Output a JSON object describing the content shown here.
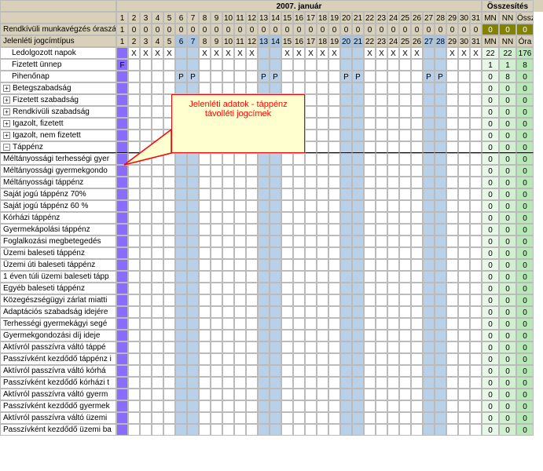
{
  "month_title": "2007. január",
  "summary_title": "Összesítés",
  "days": [
    1,
    2,
    3,
    4,
    5,
    6,
    7,
    8,
    9,
    10,
    11,
    12,
    13,
    14,
    15,
    16,
    17,
    18,
    19,
    20,
    21,
    22,
    23,
    24,
    25,
    26,
    27,
    28,
    29,
    30,
    31
  ],
  "weekend_days": [
    6,
    7,
    13,
    14,
    20,
    21,
    27,
    28
  ],
  "sum_headers": [
    "MN",
    "NN",
    "Össz"
  ],
  "sum_headers2": [
    "MN",
    "NN",
    "Óra"
  ],
  "hours_row": {
    "label": "Rendkívüli munkavégzés óraszám",
    "vals": [
      "1",
      "0",
      "0",
      "0",
      "0",
      "0",
      "0",
      "0",
      "0",
      "0",
      "0",
      "0",
      "0",
      "0",
      "0",
      "0",
      "0",
      "0",
      "0",
      "0",
      "0",
      "0",
      "0",
      "0",
      "0",
      "0",
      "0",
      "0",
      "0",
      "0",
      "0"
    ],
    "sum": [
      "0",
      "0",
      "0"
    ]
  },
  "section_label": "Jelenléti jogcímtípus",
  "main_rows": [
    {
      "label": "Ledolgozott napok",
      "expand": null,
      "indent": true,
      "first_purple": true,
      "marks": {
        "2": "X",
        "3": "X",
        "4": "X",
        "5": "X",
        "8": "X",
        "9": "X",
        "10": "X",
        "11": "X",
        "12": "X",
        "15": "X",
        "16": "X",
        "17": "X",
        "18": "X",
        "19": "X",
        "22": "X",
        "23": "X",
        "24": "X",
        "25": "X",
        "26": "X",
        "29": "X",
        "30": "X",
        "31": "X"
      },
      "sum": [
        "22",
        "22",
        "176"
      ]
    },
    {
      "label": "Fizetett ünnep",
      "expand": null,
      "indent": true,
      "first_purple": true,
      "marks": {
        "1": "F"
      },
      "sum": [
        "1",
        "1",
        "8"
      ]
    },
    {
      "label": "Pihenőnap",
      "expand": null,
      "indent": true,
      "first_purple": true,
      "marks": {
        "6": "P",
        "7": "P",
        "13": "P",
        "14": "P",
        "20": "P",
        "21": "P",
        "27": "P",
        "28": "P"
      },
      "sum": [
        "0",
        "8",
        "0"
      ]
    },
    {
      "label": "Betegszabadság",
      "expand": "+",
      "indent": false,
      "first_purple": true,
      "marks": {},
      "sum": [
        "0",
        "0",
        "0"
      ]
    },
    {
      "label": "Fizetett szabadság",
      "expand": "+",
      "indent": false,
      "first_purple": true,
      "marks": {},
      "sum": [
        "0",
        "0",
        "0"
      ]
    },
    {
      "label": "Rendkívüli szabadság",
      "expand": "+",
      "indent": false,
      "first_purple": true,
      "marks": {},
      "sum": [
        "0",
        "0",
        "0"
      ]
    },
    {
      "label": "Igazolt, fizetett",
      "expand": "+",
      "indent": false,
      "first_purple": true,
      "marks": {},
      "sum": [
        "0",
        "0",
        "0"
      ]
    },
    {
      "label": "Igazolt, nem fizetett",
      "expand": "+",
      "indent": false,
      "first_purple": true,
      "marks": {},
      "sum": [
        "0",
        "0",
        "0"
      ]
    },
    {
      "label": "Táppénz",
      "expand": "−",
      "indent": false,
      "first_purple": true,
      "marks": {},
      "sum": [
        "0",
        "0",
        "0"
      ],
      "thick": true
    }
  ],
  "sub_rows": [
    "Méltányossági terhességi gyer",
    "Méltányossági gyermekgondo",
    "Méltányossági táppénz",
    "Saját jogú táppénz 70%",
    "Saját jogú táppénz 60 %",
    "Kórházi táppénz",
    "Gyermekápolási táppénz",
    "Foglalkozási megbetegedés",
    "Üzemi baleseti táppénz",
    "Üzemi úti baleseti táppénz",
    "1 éven túli üzemi baleseti tápp",
    "Egyéb baleseti táppénz",
    "Közegészségügyi zárlat miatti",
    "Adaptációs szabadság idejére",
    "Terhességi gyermekágyi segé",
    "Gyermekgondozási díj ideje",
    "Aktívról passzívra váltó táppé",
    "Passzívként kezdődő táppénz i",
    "Aktívról passzívra váltó kórhá",
    "Passzívként kezdődő kórházi t",
    "Aktívról passzívra váltó gyerm",
    "Passzívként kezdődő gyermek",
    "Aktívról passzívra váltó üzemi",
    "Passzívként kezdődő üzemi ba"
  ],
  "callout_text1": "Jelenléti adatok - táppénz",
  "callout_text2": "távolléti jogcímek"
}
